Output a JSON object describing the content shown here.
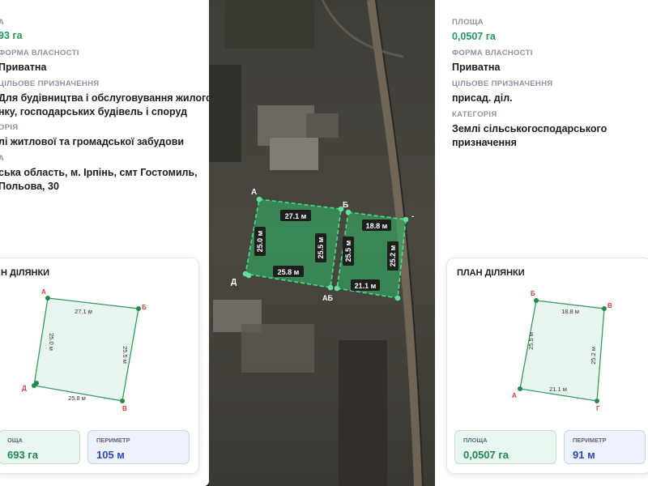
{
  "left": {
    "area": {
      "label": "А",
      "value": "93 га"
    },
    "ownership": {
      "label": "ФОРМА ВЛАСНОСТІ",
      "value": "Приватна"
    },
    "purpose": {
      "label": "ЦІЛЬОВЕ ПРИЗНАЧЕННЯ",
      "value": "Для будівництва і обслуговування жилого\nнку, господарських будівель і споруд"
    },
    "category": {
      "label": "ОРІЯ",
      "value": "лі житлової та громадської забудови"
    },
    "address": {
      "label": "А",
      "value": "ська область, м. Ірпінь, смт Гостомиль,\nПольова, 30"
    },
    "plan_title": "Н ДІЛЯНКИ",
    "plan": {
      "side_top": "27.1 м",
      "side_right": "25.5 м",
      "side_bottom": "25.8 м",
      "side_left": "25.0 м",
      "v_a": "А",
      "v_b": "Б",
      "v_v": "В",
      "v_d": "Д"
    },
    "stat_area": {
      "label": "ОЩА",
      "value": "693 га"
    },
    "stat_perimeter": {
      "label": "ПЕРИМЕТР",
      "value": "105 м"
    }
  },
  "map": {
    "parcel1": {
      "top": "27.1 м",
      "left": "25.0 м",
      "right": "25.5 м",
      "bottom": "25.8 м"
    },
    "parcel2": {
      "top": "18.8 м",
      "left": "25.5 м",
      "right": "25.2 м",
      "bottom": "21.1 м"
    },
    "v_a": "А",
    "v_b": "Б",
    "v_d": "Д",
    "v_ab": "АБ",
    "v_dash": "-"
  },
  "right": {
    "area": {
      "label": "ПЛОЩА",
      "value": "0,0507 га"
    },
    "ownership": {
      "label": "ФОРМА ВЛАСНОСТІ",
      "value": "Приватна"
    },
    "purpose": {
      "label": "ЦІЛЬОВЕ ПРИЗНАЧЕННЯ",
      "value": "присад. діл."
    },
    "category": {
      "label": "КАТЕГОРІЯ",
      "value": "Землі сільськогосподарського\nпризначення"
    },
    "plan_title": "ПЛАН ДІЛЯНКИ",
    "plan": {
      "side_top": "18.8 м",
      "side_right": "25.2 м",
      "side_bottom": "21.1 м",
      "side_left": "25.5 м",
      "v_b": "Б",
      "v_v": "В",
      "v_a": "А",
      "v_g": "Г"
    },
    "stat_area": {
      "label": "ПЛОЩА",
      "value": "0,0507 га"
    },
    "stat_perimeter": {
      "label": "ПЕРИМЕТР",
      "value": "91 м"
    }
  },
  "colors": {
    "green": "#1f9b5a",
    "parcel_stroke": "#3cd27a",
    "vertex_red": "#d83a2a",
    "perimeter_blue": "#2a46c8"
  }
}
